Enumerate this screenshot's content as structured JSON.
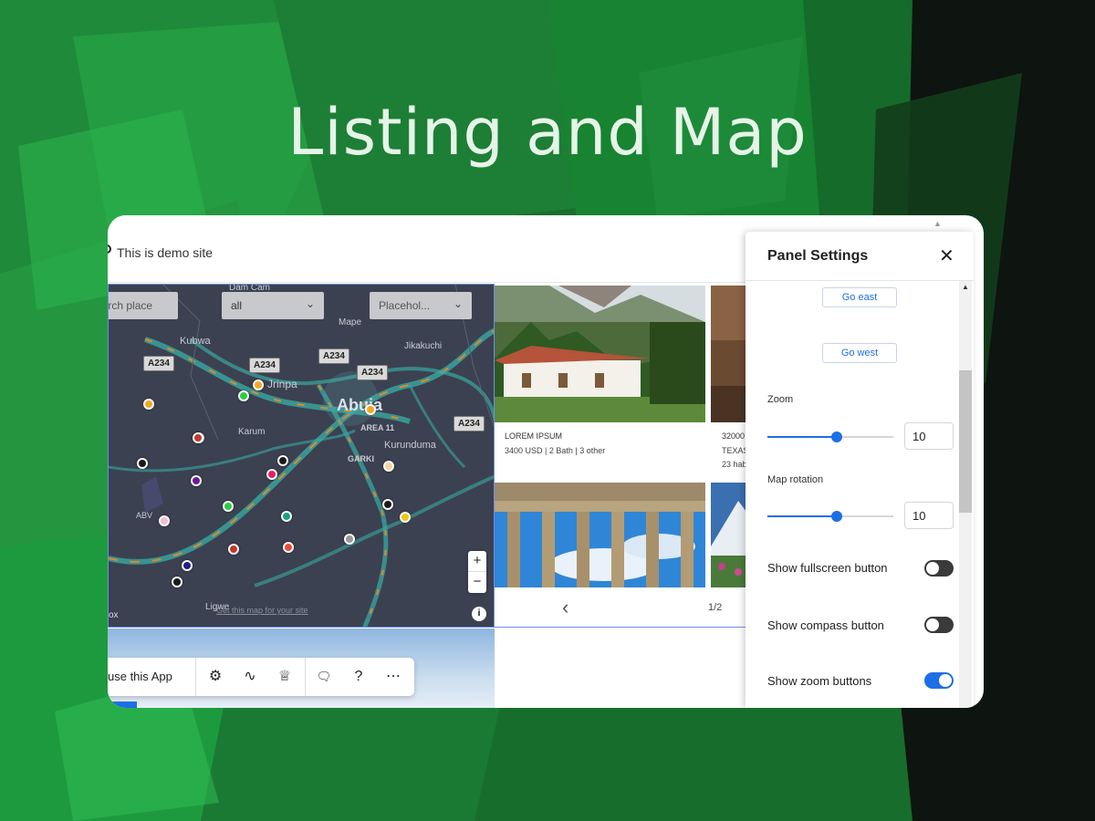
{
  "hero": {
    "title": "Listing and Map"
  },
  "site": {
    "demo_text": "This is demo site"
  },
  "map": {
    "search_placeholder": "Search place",
    "category_value": "all",
    "filter_placeholder": "Placehol...",
    "road_badges": [
      "A234",
      "A234",
      "A234",
      "A234",
      "A234"
    ],
    "place_labels": [
      "Mape",
      "Kubwa",
      "Jikakuchi",
      "Karum",
      "Kurunduma",
      "ABV",
      "Ligwe"
    ],
    "partial_labels": [
      "Dam Cam",
      "Jrinpa",
      "AREA 11",
      "GARKI"
    ],
    "city": "Abuja",
    "zoom_in": "+",
    "zoom_out": "−",
    "info": "i",
    "attribution": "Get this map for your site",
    "corner_label": "ox",
    "marker_colors": [
      "#f5a623",
      "#2ecc40",
      "#f5a623",
      "#c0392b",
      "#1a1a1a",
      "#6a1b9a",
      "#e91e63",
      "#1a1a1a",
      "#2ecc40",
      "#f8bbd0",
      "#1d1d8c",
      "#c0392b",
      "#16a085",
      "#e74c3c",
      "#c0392b",
      "#f5a623",
      "#1a1a1a",
      "#f1c40f",
      "#999999",
      "#1a1a1a",
      "#f0d5a0"
    ]
  },
  "listing": {
    "items": [
      {
        "title": "LOREM IPSUM",
        "meta": "3400 USD | 2 Bath | 3 other"
      },
      {
        "title": "32000",
        "meta": "TEXAS",
        "extra": "23 hab"
      }
    ],
    "pager": {
      "prev": "‹",
      "page": "1/2"
    }
  },
  "toolbar": {
    "label": "use this App",
    "icons": [
      "gear-icon",
      "route-icon",
      "crown-icon",
      "comment-icon",
      "help-icon",
      "more-icon"
    ],
    "glyphs": [
      "⚙",
      "∿",
      "♕",
      "🗨",
      "?",
      "⋯"
    ]
  },
  "panel": {
    "title": "Panel Settings",
    "close": "✕",
    "go_east": "Go east",
    "go_west": "Go west",
    "zoom_label": "Zoom",
    "zoom_value": "10",
    "rotation_label": "Map rotation",
    "rotation_value": "10",
    "zoom_slider_fraction": 0.55,
    "rotation_slider_fraction": 0.55,
    "toggles": [
      {
        "label": "Show fullscreen button",
        "on": false
      },
      {
        "label": "Show compass button",
        "on": false
      },
      {
        "label": "Show zoom buttons",
        "on": true
      }
    ]
  },
  "colors": {
    "accent": "#1d6fe6",
    "map_bg": "#3b4150",
    "bg_green": "#1f8a3a"
  }
}
